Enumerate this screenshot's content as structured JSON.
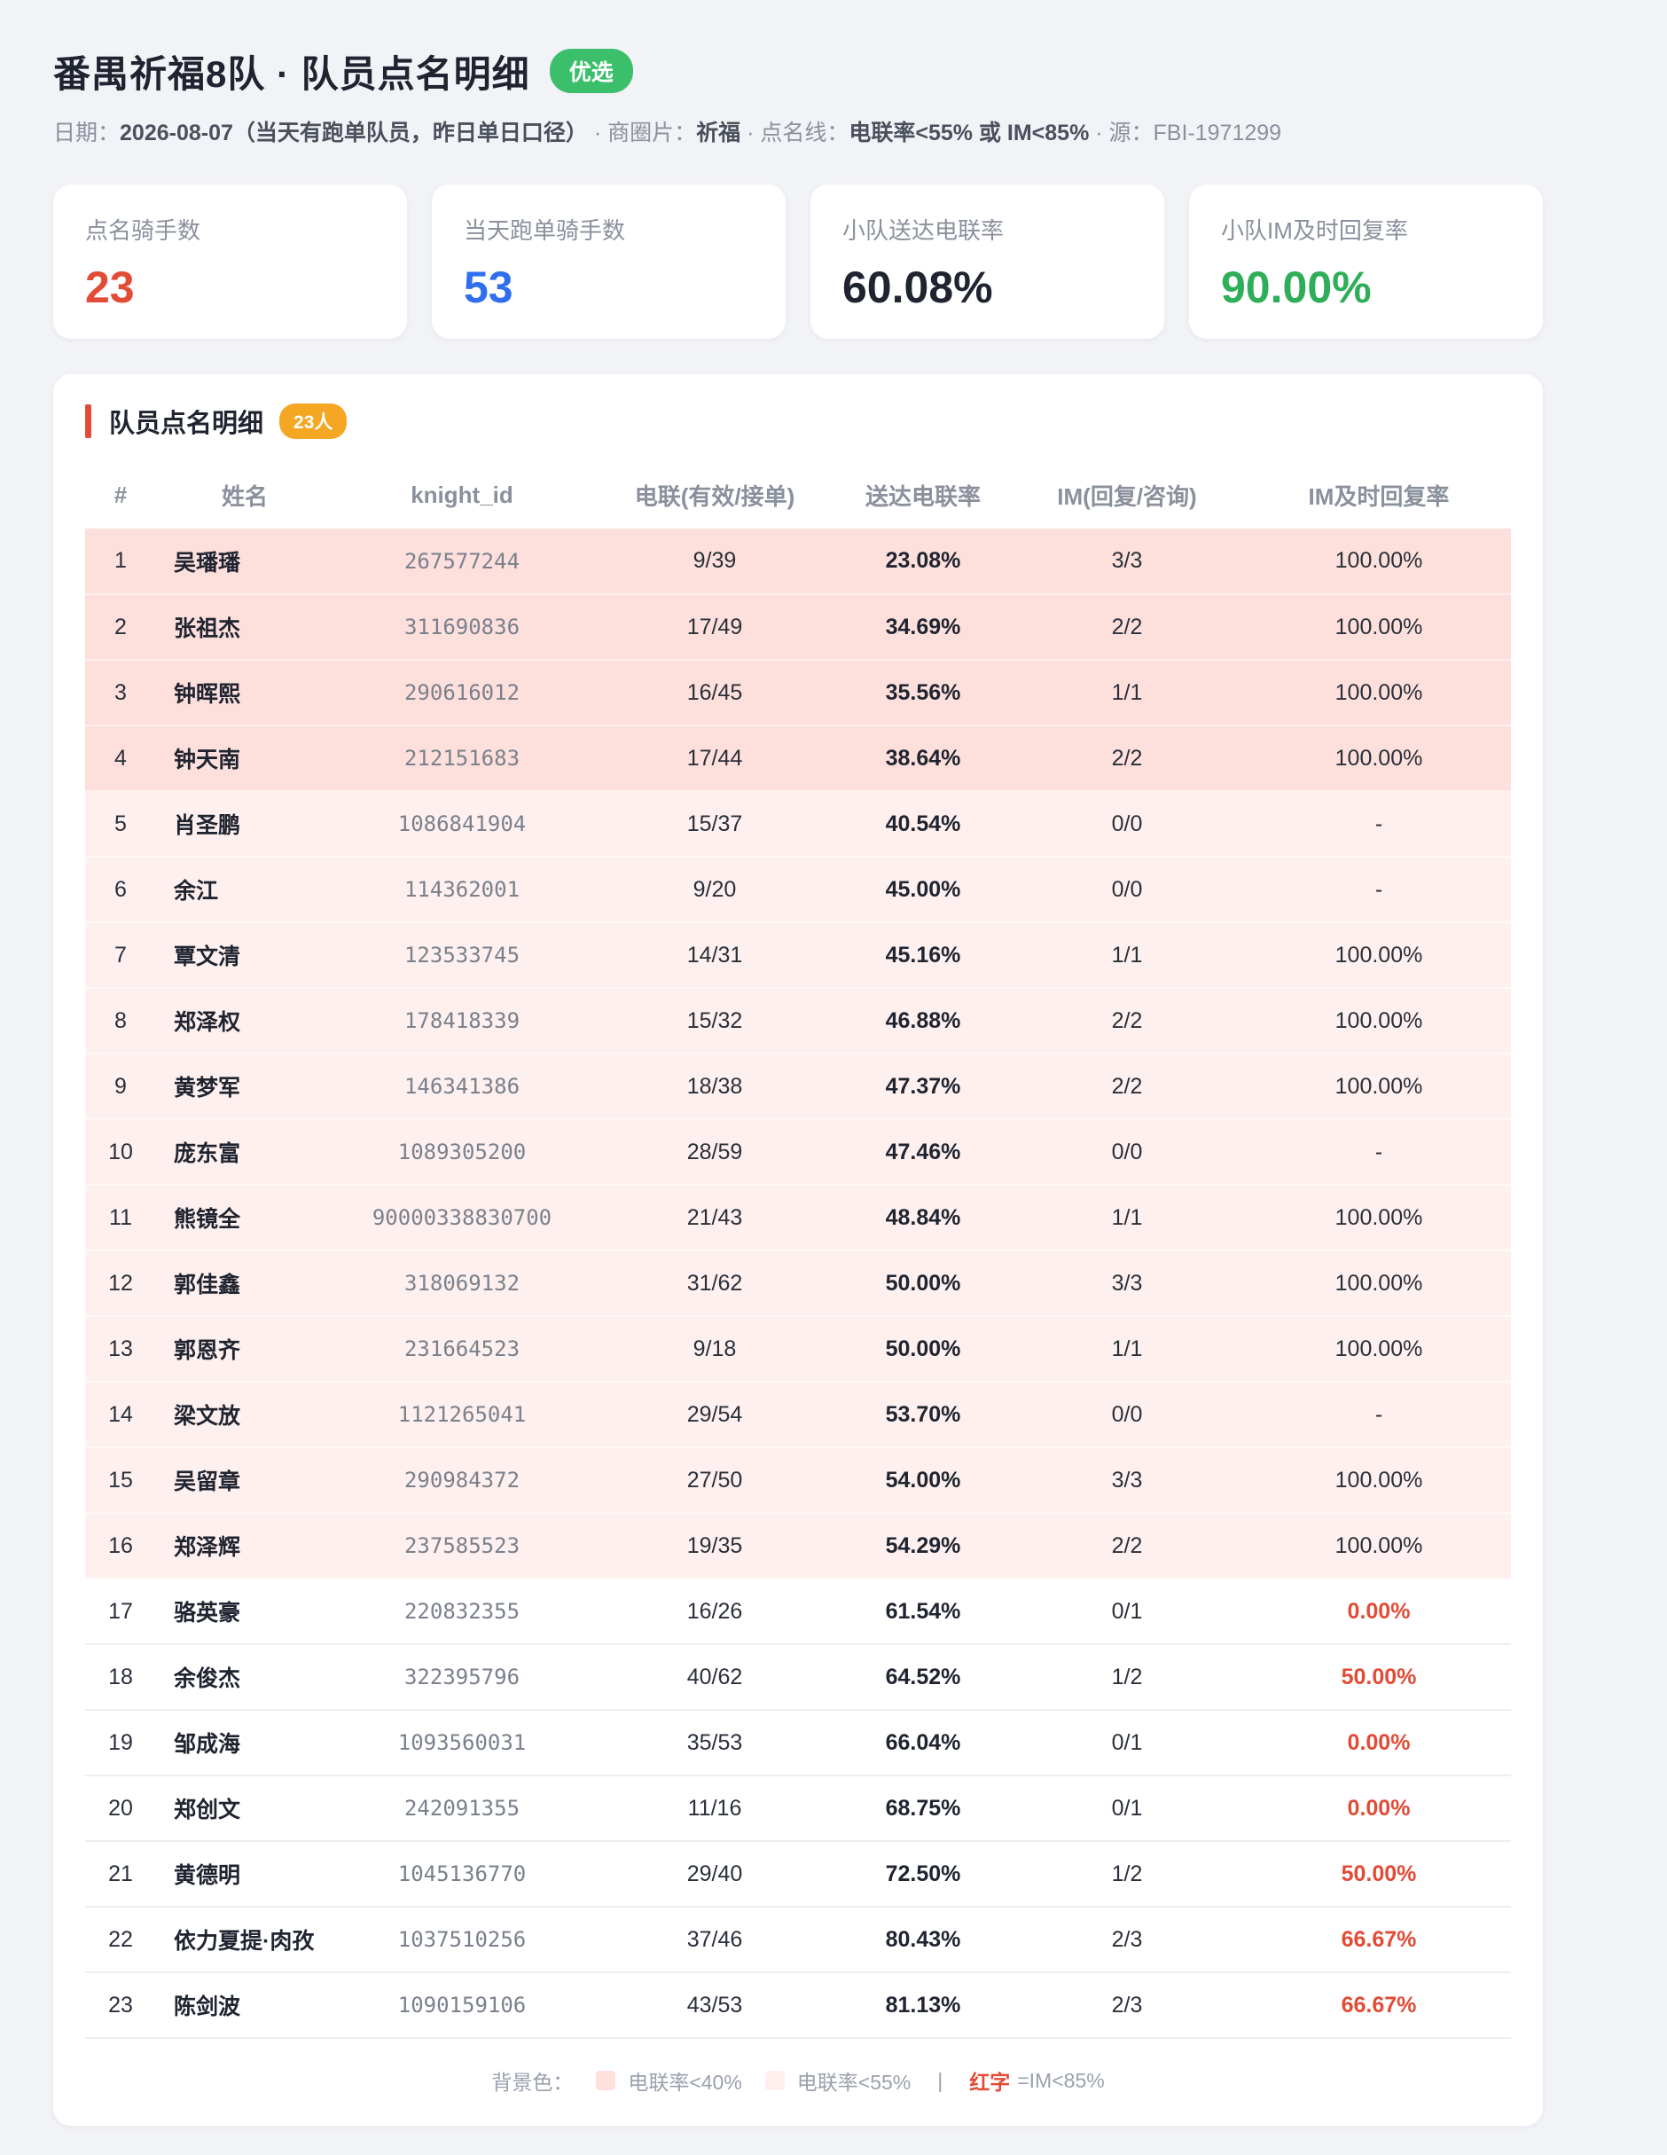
{
  "header": {
    "title": "番禺祈福8队 · 队员点名明细",
    "badge": "优选",
    "date_label": "日期：",
    "date_value": "2026-08-07（当天有跑单队员，昨日单日口径）",
    "area_label": " · 商圈片：",
    "area_value": "祈福",
    "line_label": " · 点名线：",
    "line_value": "电联率<55% 或 IM<85%",
    "source_text": " · 源：FBI-1971299"
  },
  "stats": [
    {
      "label": "点名骑手数",
      "value": "23",
      "color": "#e24b36"
    },
    {
      "label": "当天跑单骑手数",
      "value": "53",
      "color": "#2f6fed"
    },
    {
      "label": "小队送达电联率",
      "value": "60.08%",
      "color": "#1f2430"
    },
    {
      "label": "小队IM及时回复率",
      "value": "90.00%",
      "color": "#2fae5a"
    }
  ],
  "table": {
    "title": "队员点名明细",
    "count_badge": "23人",
    "columns": [
      "#",
      "姓名",
      "knight_id",
      "电联(有效/接单)",
      "送达电联率",
      "IM(回复/咨询)",
      "IM及时回复率"
    ],
    "rows": [
      {
        "no": "1",
        "name": "吴璠璠",
        "kid": "267577244",
        "call": "9/39",
        "rate": "23.08%",
        "im": "3/3",
        "imrate": "100.00%",
        "level": "lvl1",
        "bad": false
      },
      {
        "no": "2",
        "name": "张祖杰",
        "kid": "311690836",
        "call": "17/49",
        "rate": "34.69%",
        "im": "2/2",
        "imrate": "100.00%",
        "level": "lvl1",
        "bad": false
      },
      {
        "no": "3",
        "name": "钟晖熙",
        "kid": "290616012",
        "call": "16/45",
        "rate": "35.56%",
        "im": "1/1",
        "imrate": "100.00%",
        "level": "lvl1",
        "bad": false
      },
      {
        "no": "4",
        "name": "钟天南",
        "kid": "212151683",
        "call": "17/44",
        "rate": "38.64%",
        "im": "2/2",
        "imrate": "100.00%",
        "level": "lvl1",
        "bad": false
      },
      {
        "no": "5",
        "name": "肖圣鹏",
        "kid": "1086841904",
        "call": "15/37",
        "rate": "40.54%",
        "im": "0/0",
        "imrate": "-",
        "level": "lvl2",
        "bad": false
      },
      {
        "no": "6",
        "name": "余江",
        "kid": "114362001",
        "call": "9/20",
        "rate": "45.00%",
        "im": "0/0",
        "imrate": "-",
        "level": "lvl2",
        "bad": false
      },
      {
        "no": "7",
        "name": "覃文清",
        "kid": "123533745",
        "call": "14/31",
        "rate": "45.16%",
        "im": "1/1",
        "imrate": "100.00%",
        "level": "lvl2",
        "bad": false
      },
      {
        "no": "8",
        "name": "郑泽权",
        "kid": "178418339",
        "call": "15/32",
        "rate": "46.88%",
        "im": "2/2",
        "imrate": "100.00%",
        "level": "lvl2",
        "bad": false
      },
      {
        "no": "9",
        "name": "黄梦军",
        "kid": "146341386",
        "call": "18/38",
        "rate": "47.37%",
        "im": "2/2",
        "imrate": "100.00%",
        "level": "lvl2",
        "bad": false
      },
      {
        "no": "10",
        "name": "庞东富",
        "kid": "1089305200",
        "call": "28/59",
        "rate": "47.46%",
        "im": "0/0",
        "imrate": "-",
        "level": "lvl2",
        "bad": false
      },
      {
        "no": "11",
        "name": "熊镜全",
        "kid": "90000338830700",
        "call": "21/43",
        "rate": "48.84%",
        "im": "1/1",
        "imrate": "100.00%",
        "level": "lvl2",
        "bad": false
      },
      {
        "no": "12",
        "name": "郭佳鑫",
        "kid": "318069132",
        "call": "31/62",
        "rate": "50.00%",
        "im": "3/3",
        "imrate": "100.00%",
        "level": "lvl2",
        "bad": false
      },
      {
        "no": "13",
        "name": "郭恩齐",
        "kid": "231664523",
        "call": "9/18",
        "rate": "50.00%",
        "im": "1/1",
        "imrate": "100.00%",
        "level": "lvl2",
        "bad": false
      },
      {
        "no": "14",
        "name": "梁文放",
        "kid": "1121265041",
        "call": "29/54",
        "rate": "53.70%",
        "im": "0/0",
        "imrate": "-",
        "level": "lvl2",
        "bad": false
      },
      {
        "no": "15",
        "name": "吴留章",
        "kid": "290984372",
        "call": "27/50",
        "rate": "54.00%",
        "im": "3/3",
        "imrate": "100.00%",
        "level": "lvl2",
        "bad": false
      },
      {
        "no": "16",
        "name": "郑泽辉",
        "kid": "237585523",
        "call": "19/35",
        "rate": "54.29%",
        "im": "2/2",
        "imrate": "100.00%",
        "level": "lvl2",
        "bad": false
      },
      {
        "no": "17",
        "name": "骆英豪",
        "kid": "220832355",
        "call": "16/26",
        "rate": "61.54%",
        "im": "0/1",
        "imrate": "0.00%",
        "level": "none",
        "bad": true
      },
      {
        "no": "18",
        "name": "余俊杰",
        "kid": "322395796",
        "call": "40/62",
        "rate": "64.52%",
        "im": "1/2",
        "imrate": "50.00%",
        "level": "none",
        "bad": true
      },
      {
        "no": "19",
        "name": "邹成海",
        "kid": "1093560031",
        "call": "35/53",
        "rate": "66.04%",
        "im": "0/1",
        "imrate": "0.00%",
        "level": "none",
        "bad": true
      },
      {
        "no": "20",
        "name": "郑创文",
        "kid": "242091355",
        "call": "11/16",
        "rate": "68.75%",
        "im": "0/1",
        "imrate": "0.00%",
        "level": "none",
        "bad": true
      },
      {
        "no": "21",
        "name": "黄德明",
        "kid": "1045136770",
        "call": "29/40",
        "rate": "72.50%",
        "im": "1/2",
        "imrate": "50.00%",
        "level": "none",
        "bad": true
      },
      {
        "no": "22",
        "name": "依力夏提·肉孜",
        "kid": "1037510256",
        "call": "37/46",
        "rate": "80.43%",
        "im": "2/3",
        "imrate": "66.67%",
        "level": "none",
        "bad": true
      },
      {
        "no": "23",
        "name": "陈剑波",
        "kid": "1090159106",
        "call": "43/53",
        "rate": "81.13%",
        "im": "2/3",
        "imrate": "66.67%",
        "level": "none",
        "bad": true
      }
    ]
  },
  "legend": {
    "prefix": "背景色：",
    "item1": "电联率<40%",
    "item2": "电联率<55%",
    "separator": "|",
    "red_label": "红字",
    "red_rule": "=IM<85%",
    "color1": "#fde0dc",
    "color2": "#fef0ee"
  }
}
